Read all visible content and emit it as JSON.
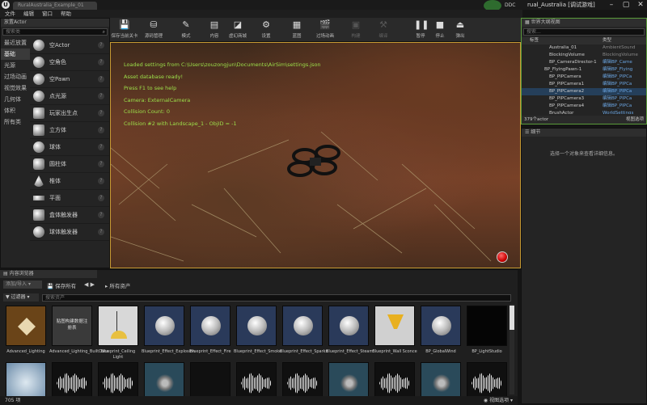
{
  "window": {
    "tab_title": "RuralAustralia_Example_01",
    "project_title": "rual_Australia [调试游戏]",
    "ddc_label": "DDC",
    "min": "–",
    "max": "▢",
    "close": "✕",
    "logo": "U"
  },
  "menu": [
    "文件",
    "编辑",
    "窗口",
    "帮助"
  ],
  "modes": {
    "tab_label": "放置Actor",
    "search_placeholder": "搜索类",
    "categories": [
      "最近放置",
      "基础",
      "光源",
      "过场动画",
      "视觉效果",
      "几何体",
      "体积",
      "所有类"
    ],
    "items": [
      "空Actor",
      "空角色",
      "空Pawn",
      "点光源",
      "玩家出生点",
      "立方体",
      "球体",
      "圆柱体",
      "椎体",
      "平面",
      "盒体触发器",
      "球体触发器"
    ],
    "help": "?"
  },
  "toolbar": {
    "buttons": [
      "保存当前关卡",
      "源码管理",
      "模式",
      "内容",
      "虚幻商城",
      "设置",
      "蓝图",
      "过场动画",
      "构建",
      "编译",
      "暂停",
      "停止",
      "弹出"
    ]
  },
  "viewport": {
    "messages": [
      "Loaded settings from C:\\Users\\zouzongjun\\Documents\\AirSim\\settings.json",
      "Asset database ready!",
      "Press F1 to see help",
      "Camera: ExternalCamera",
      "Collision Count: 0",
      "Collision #2 with Landscape_1 - ObjID = -1"
    ]
  },
  "outliner": {
    "tab": "世界大纲视图",
    "search_placeholder": "搜索...",
    "col_label": "标签",
    "col_type": "类型",
    "rows": [
      {
        "label": "Australia_01",
        "type": "AmbientSound"
      },
      {
        "label": "BlockingVolume",
        "type": "BlockingVolume"
      },
      {
        "label": "BP_CameraDirector-1",
        "type": "编辑BP_Came"
      },
      {
        "label": "BP_FlyingPawn-1",
        "type": "编辑BP_Flying"
      },
      {
        "label": "BP_PIPCamera",
        "type": "编辑BP_PIPCa"
      },
      {
        "label": "BP_PIPCamera1",
        "type": "编辑BP_PIPCa"
      },
      {
        "label": "BP_PIPCamera2",
        "type": "编辑BP_PIPCa"
      },
      {
        "label": "BP_PIPCamera3",
        "type": "编辑BP_PIPCa"
      },
      {
        "label": "BP_PIPCamera4",
        "type": "编辑BP_PIPCa"
      },
      {
        "label": "BrushActor",
        "type": "WorldSettings"
      }
    ],
    "count": "379个actor",
    "view_options": "视图选项"
  },
  "details": {
    "tab": "细节",
    "empty_message": "选择一个对象来查看详细信息。"
  },
  "content_browser": {
    "tab": "内容浏览器",
    "add_import": "添加/导入",
    "save_all": "保存所有",
    "path": "所有资产",
    "filter": "过滤器",
    "search_placeholder": "搜索资产",
    "count": "705 项",
    "view_options": "视图选项",
    "row1": [
      "Advanced_Lighting",
      "Advanced_Lighting_BuiltData",
      "Blueprint_Ceiling Light",
      "Blueprint_Effect_Explosion",
      "Blueprint_Effect_Fire",
      "Blueprint_Effect_Smoke",
      "Blueprint_Effect_Sparks",
      "Blueprint_Effect_Steam",
      "Blueprint_Wall Sconce",
      "BP_GlobalWind",
      "BP_LightStudio"
    ],
    "builtdata_text": "贴图构建数据注册表"
  },
  "colors": {
    "viewport_text": "#9ce04a",
    "link_blue": "#6aa4e0",
    "selection": "#253f5a",
    "accent_green": "#5a9a3a"
  }
}
